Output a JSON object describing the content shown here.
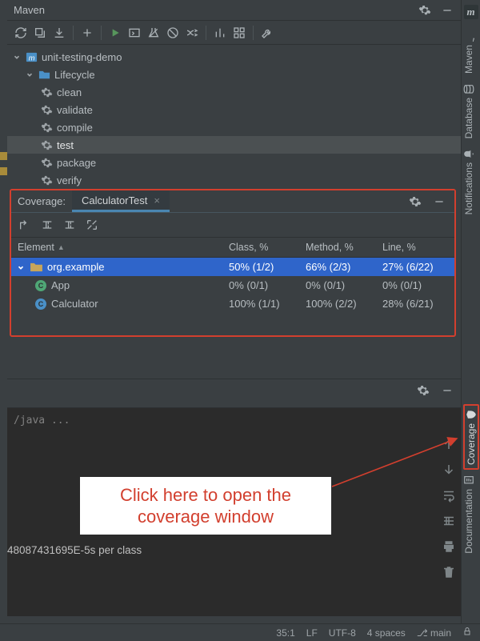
{
  "maven": {
    "title": "Maven",
    "project": "unit-testing-demo",
    "lifecycle_label": "Lifecycle",
    "lifecycle_items": [
      "clean",
      "validate",
      "compile",
      "test",
      "package",
      "verify"
    ],
    "selected_item": "test"
  },
  "coverage": {
    "title": "Coverage:",
    "tab_label": "CalculatorTest",
    "columns": {
      "element": "Element",
      "class": "Class, %",
      "method": "Method, %",
      "line": "Line, %"
    },
    "rows": [
      {
        "kind": "package",
        "name": "org.example",
        "class": "50% (1/2)",
        "method": "66% (2/3)",
        "line": "27% (6/22)",
        "selected": true
      },
      {
        "kind": "class-green",
        "name": "App",
        "class": "0% (0/1)",
        "method": "0% (0/1)",
        "line": "0% (0/1)"
      },
      {
        "kind": "class-blue",
        "name": "Calculator",
        "class": "100% (1/1)",
        "method": "100% (2/2)",
        "line": "28% (6/21)"
      }
    ]
  },
  "console": {
    "path": "/java ...",
    "output": "48087431695E-5s per class"
  },
  "annotation": "Click here to open the coverage window",
  "right_rail": {
    "items": [
      "Maven",
      "Database",
      "Notifications",
      "Coverage",
      "Documentation"
    ],
    "selected": "Coverage"
  },
  "status_bar": {
    "cursor": "35:1",
    "line_ending": "LF",
    "encoding": "UTF-8",
    "indent": "4 spaces",
    "branch_icon": "⎇",
    "branch": "main"
  }
}
